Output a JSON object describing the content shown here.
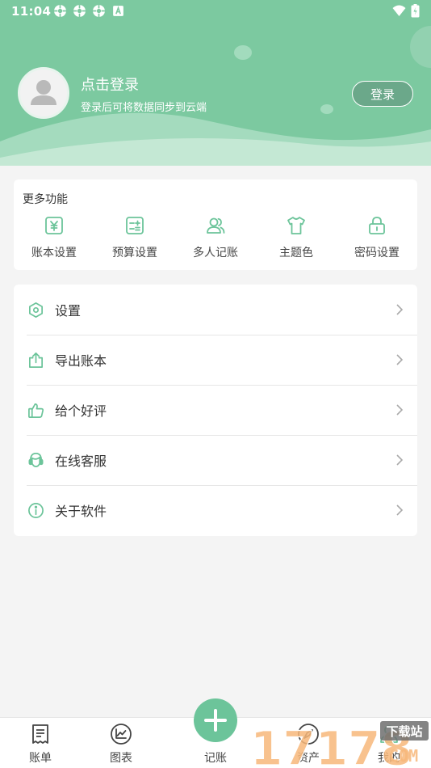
{
  "status_bar": {
    "time": "11:04"
  },
  "profile": {
    "title": "点击登录",
    "subtitle": "登录后可将数据同步到云端",
    "login_button": "登录"
  },
  "more_functions": {
    "title": "更多功能",
    "items": [
      {
        "label": "账本设置",
        "icon": "yuan-icon"
      },
      {
        "label": "预算设置",
        "icon": "budget-icon"
      },
      {
        "label": "多人记账",
        "icon": "users-icon"
      },
      {
        "label": "主题色",
        "icon": "tshirt-icon"
      },
      {
        "label": "密码设置",
        "icon": "lock-icon"
      }
    ]
  },
  "menu": [
    {
      "label": "设置",
      "icon": "hexagon-settings-icon"
    },
    {
      "label": "导出账本",
      "icon": "export-icon"
    },
    {
      "label": "给个好评",
      "icon": "thumbs-up-icon"
    },
    {
      "label": "在线客服",
      "icon": "customer-service-icon"
    },
    {
      "label": "关于软件",
      "icon": "info-icon"
    }
  ],
  "tabbar": [
    {
      "label": "账单",
      "icon": "bill-icon"
    },
    {
      "label": "图表",
      "icon": "chart-icon"
    },
    {
      "label": "记账",
      "icon": "plus-icon"
    },
    {
      "label": "资产",
      "icon": "compass-icon"
    },
    {
      "label": "我的",
      "icon": "profile-icon"
    }
  ],
  "watermark": {
    "text": "17178",
    "sub": "下载站",
    "domain": "COM"
  },
  "colors": {
    "accent": "#7cc9a0",
    "icon_green": "#6cc49a",
    "plus_button": "#6cc49a"
  }
}
